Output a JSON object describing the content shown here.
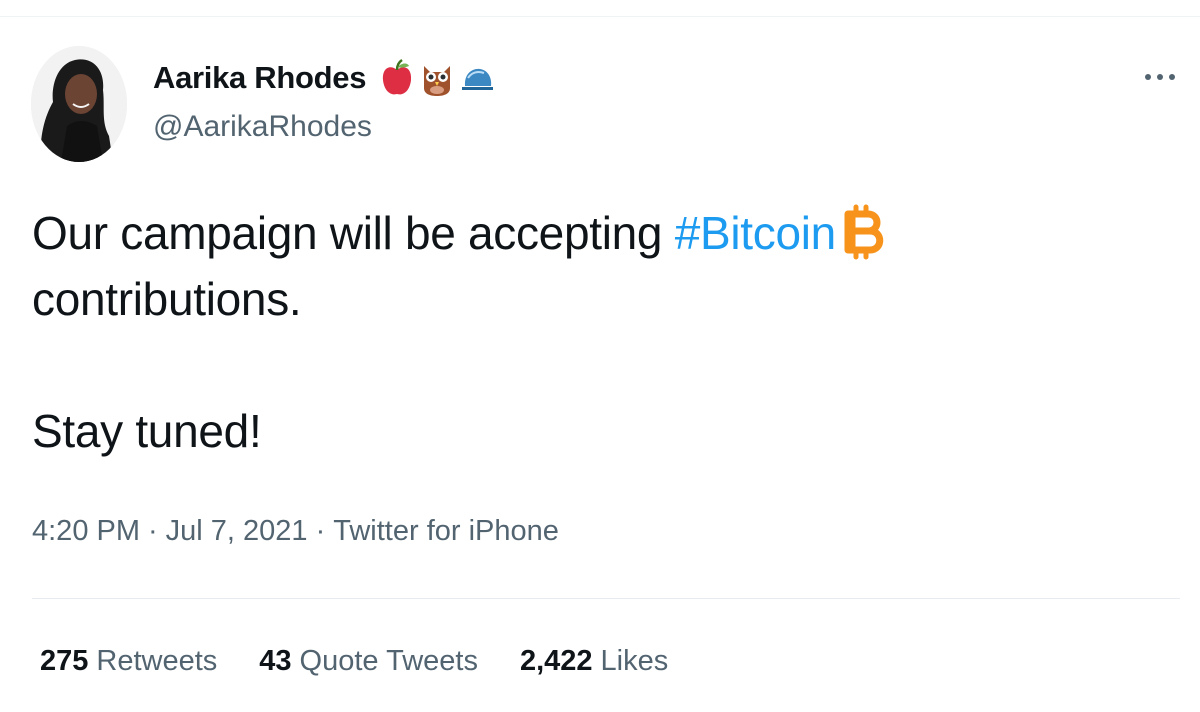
{
  "author": {
    "display_name": "Aarika Rhodes",
    "handle": "@AarikaRhodes",
    "name_emojis": [
      "apple-icon",
      "owl-icon",
      "blue-cap-icon"
    ]
  },
  "tweet": {
    "text_before_hashtag": "Our campaign will be accepting ",
    "hashtag": "#Bitcoin",
    "text_after_hashtag": "contributions.",
    "second_paragraph": "Stay tuned!",
    "icon_after_hashtag": "bitcoin-icon"
  },
  "meta": {
    "time": "4:20 PM",
    "separator": "·",
    "date": "Jul 7, 2021",
    "source": "Twitter for iPhone"
  },
  "stats": {
    "retweets_count": "275",
    "retweets_label": "Retweets",
    "quotes_count": "43",
    "quotes_label": "Quote Tweets",
    "likes_count": "2,422",
    "likes_label": "Likes"
  },
  "colors": {
    "hashtag": "#1d9bf0",
    "secondary_text": "#536471",
    "primary_text": "#0f1419",
    "bitcoin": "#f7931a"
  }
}
